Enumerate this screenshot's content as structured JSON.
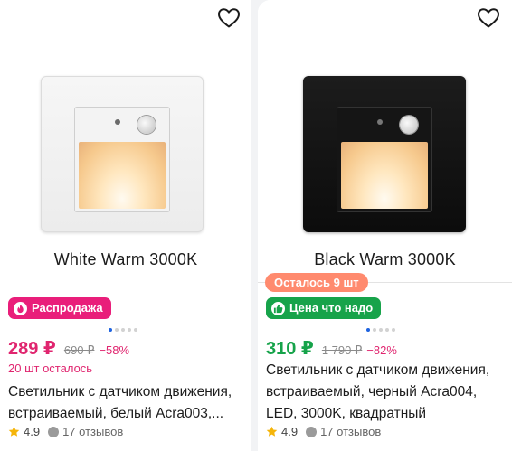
{
  "products": [
    {
      "variant_label": "White Warm 3000K",
      "badge": "Распродажа",
      "price": "289 ₽",
      "old_price": "690 ₽",
      "discount": "−58%",
      "left_count": "20 шт осталось",
      "title_lines": [
        "Светильник с датчиком движения,",
        "встраиваемый, белый Acra003,..."
      ],
      "rating": "4.9",
      "reviews": "17 отзывов",
      "image_dots": 5,
      "active_dot": 0,
      "colors": {
        "badge": "#e91e7a",
        "price": "#e0256f"
      }
    },
    {
      "variant_label": "Black Warm 3000K",
      "stock_pill": "Осталось 9 шт",
      "badge": "Цена что надо",
      "price": "310 ₽",
      "old_price": "1 790 ₽",
      "discount": "−82%",
      "title_lines": [
        "Светильник с датчиком движения,",
        "встраиваемый, черный Acra004,",
        "LED, 3000K, квадратный"
      ],
      "rating": "4.9",
      "reviews": "17 отзывов",
      "image_dots": 5,
      "active_dot": 0,
      "colors": {
        "badge": "#17a34a",
        "price": "#16a34a"
      }
    }
  ],
  "icons": {
    "favorite": "heart-outline-icon",
    "sale_badge": "fire-icon",
    "good_price_badge": "thumbs-up-icon",
    "rating": "star-icon",
    "reviews": "chat-bubble-icon"
  }
}
